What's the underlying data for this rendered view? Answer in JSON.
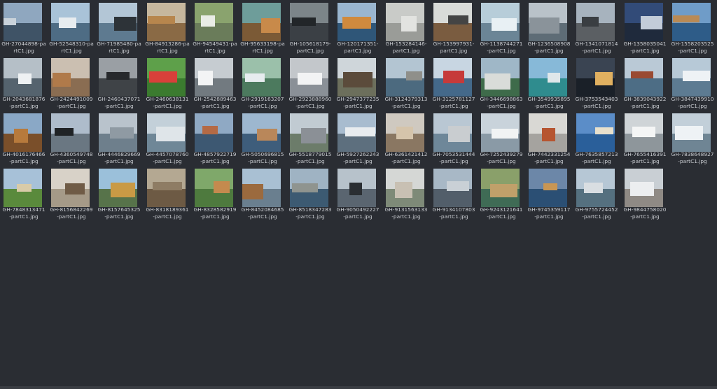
{
  "window": {
    "background": "#2a2d33"
  },
  "files": [
    {
      "name": "GH-27044898-partC1.jpg",
      "line1": "GH-27044898-pa",
      "line2": "rtC1.jpg",
      "sky": "#8fa7bf",
      "ground": "#3f5366",
      "bldg": "#c9d2da"
    },
    {
      "name": "GH-52548310-partC1.jpg",
      "line1": "GH-52548310-pa",
      "line2": "rtC1.jpg",
      "sky": "#a9c3d8",
      "ground": "#4e6c84",
      "bldg": "#e7ecef"
    },
    {
      "name": "GH-71985480-partC1.jpg",
      "line1": "GH-71985480-pa",
      "line2": "rtC1.jpg",
      "sky": "#b3c6d6",
      "ground": "#5e7a90",
      "bldg": "#2d3338"
    },
    {
      "name": "GH-84913286-partC1.jpg",
      "line1": "GH-84913286-pa",
      "line2": "rtC1.jpg",
      "sky": "#c6b79e",
      "ground": "#8a6a45",
      "bldg": "#b7864d"
    },
    {
      "name": "GH-94549431-partC1.jpg",
      "line1": "GH-94549431-pa",
      "line2": "rtC1.jpg",
      "sky": "#8aa36e",
      "ground": "#6a7c5a",
      "bldg": "#e9ece6"
    },
    {
      "name": "GH-95633198-partC1.jpg",
      "line1": "GH-95633198-pa",
      "line2": "rtC1.jpg",
      "sky": "#6e9d9a",
      "ground": "#7b5a36",
      "bldg": "#c88a4a"
    },
    {
      "name": "GH-105618179-partC1.jpg",
      "line1": "GH-105618179-",
      "line2": "partC1.jpg",
      "sky": "#7c8589",
      "ground": "#3b4045",
      "bldg": "#222629"
    },
    {
      "name": "GH-120171351-partC1.jpg",
      "line1": "GH-120171351-",
      "line2": "partC1.jpg",
      "sky": "#9ab6d0",
      "ground": "#2f5678",
      "bldg": "#d08a3e"
    },
    {
      "name": "GH-153284146-partC1.jpg",
      "line1": "GH-153284146-",
      "line2": "partC1.jpg",
      "sky": "#c9cbc8",
      "ground": "#9a9c98",
      "bldg": "#e2e3e0"
    },
    {
      "name": "GH-153997931-partC1.jpg",
      "line1": "GH-153997931-",
      "line2": "partC1.jpg",
      "sky": "#d9dbd8",
      "ground": "#7a5c40",
      "bldg": "#444"
    },
    {
      "name": "GH-1138744271-partC1.jpg",
      "line1": "GH-1138744271",
      "line2": "-partC1.jpg",
      "sky": "#b7cdd9",
      "ground": "#6b8596",
      "bldg": "#e8f0f4"
    },
    {
      "name": "GH-1236508908-partC1.jpg",
      "line1": "GH-1236508908",
      "line2": "-partC1.jpg",
      "sky": "#b9c2c9",
      "ground": "#5e6c76",
      "bldg": "#8a939a"
    },
    {
      "name": "GH-1341071814-partC1.jpg",
      "line1": "GH-1341071814",
      "line2": "-partC1.jpg",
      "sky": "#a7b3be",
      "ground": "#5b5f63",
      "bldg": "#3a3e42"
    },
    {
      "name": "GH-1358035041-partC1.jpg",
      "line1": "GH-1358035041",
      "line2": "-partC1.jpg",
      "sky": "#324b78",
      "ground": "#1f2a3c",
      "bldg": "#c3ccd9"
    },
    {
      "name": "GH-1558203525-partC1.jpg",
      "line1": "GH-1558203525",
      "line2": "-partC1.jpg",
      "sky": "#6f9cc8",
      "ground": "#2e5c88",
      "bldg": "#b98a55"
    },
    {
      "name": "GH-2043681876-partC1.jpg",
      "line1": "GH-2043681876",
      "line2": "-partC1.jpg",
      "sky": "#b5bfc7",
      "ground": "#55636e",
      "bldg": "#eef1f3"
    },
    {
      "name": "GH-2424491009-partC1.jpg",
      "line1": "GH-2424491009",
      "line2": "-partC1.jpg",
      "sky": "#cbbfb1",
      "ground": "#8a6d52",
      "bldg": "#b07a4a"
    },
    {
      "name": "GH-2460437071-partC1.jpg",
      "line1": "GH-2460437071",
      "line2": "-partC1.jpg",
      "sky": "#9a9fa4",
      "ground": "#3f4347",
      "bldg": "#27292c"
    },
    {
      "name": "GH-2460638131-partC1.jpg",
      "line1": "GH-2460638131",
      "line2": "-partC1.jpg",
      "sky": "#5ea04a",
      "ground": "#3b7b2f",
      "bldg": "#d8403a"
    },
    {
      "name": "GH-2542889463-partC1.jpg",
      "line1": "GH-2542889463",
      "line2": "-partC1.jpg",
      "sky": "#c6ccd1",
      "ground": "#727a80",
      "bldg": "#f3f4f5"
    },
    {
      "name": "GH-2919163207-partC1.jpg",
      "line1": "GH-2919163207",
      "line2": "-partC1.jpg",
      "sky": "#9bc0aa",
      "ground": "#4c7a5e",
      "bldg": "#e7ecef"
    },
    {
      "name": "GH-2923888960-partC1.jpg",
      "line1": "GH-2923888960",
      "line2": "-partC1.jpg",
      "sky": "#c3c7cb",
      "ground": "#8a9097",
      "bldg": "#f2f3f4"
    },
    {
      "name": "GH-2947377235-partC1.jpg",
      "line1": "GH-2947377235",
      "line2": "-partC1.jpg",
      "sky": "#cfd6da",
      "ground": "#6c6f5c",
      "bldg": "#5b4b3b"
    },
    {
      "name": "GH-3124379313-partC1.jpg",
      "line1": "GH-3124379313",
      "line2": "-partC1.jpg",
      "sky": "#b3c5d2",
      "ground": "#4c6a7f",
      "bldg": "#8f8f8a"
    },
    {
      "name": "GH-3125781127-partC1.jpg",
      "line1": "GH-3125781127",
      "line2": "-partC1.jpg",
      "sky": "#c8d6e2",
      "ground": "#44698a",
      "bldg": "#c63a3a"
    },
    {
      "name": "GH-3446698863-partC1.jpg",
      "line1": "GH-3446698863",
      "line2": "-partC1.jpg",
      "sky": "#9fb7c7",
      "ground": "#3e6b4a",
      "bldg": "#d9dcd9"
    },
    {
      "name": "GH-3549935895-partC1.jpg",
      "line1": "GH-3549935895",
      "line2": "-partC1.jpg",
      "sky": "#87b9d8",
      "ground": "#2f8c8e",
      "bldg": "#dfe7ea"
    },
    {
      "name": "GH-3753543403-partC1.jpg",
      "line1": "GH-3753543403",
      "line2": "-partC1.jpg",
      "sky": "#3a4452",
      "ground": "#1a2028",
      "bldg": "#e0b060"
    },
    {
      "name": "GH-3839043922-partC1.jpg",
      "line1": "GH-3839043922",
      "line2": "-partC1.jpg",
      "sky": "#bac9d6",
      "ground": "#4d6d85",
      "bldg": "#9a4a32"
    },
    {
      "name": "GH-3847439910-partC1.jpg",
      "line1": "GH-3847439910",
      "line2": "-partC1.jpg",
      "sky": "#b7c9d7",
      "ground": "#5d7b92",
      "bldg": "#eef2f5"
    },
    {
      "name": "GH-4016176466-partC1.jpg",
      "line1": "GH-4016176466",
      "line2": "-partC1.jpg",
      "sky": "#8aa8c6",
      "ground": "#7a4f2a",
      "bldg": "#b77a3c"
    },
    {
      "name": "GH-4360549748-partC1.jpg",
      "line1": "GH-4360549748",
      "line2": "-partC1.jpg",
      "sky": "#aebccb",
      "ground": "#6a7782",
      "bldg": "#202326"
    },
    {
      "name": "GH-4446829669-partC1.jpg",
      "line1": "GH-4446829669",
      "line2": "-partC1.jpg",
      "sky": "#b9c3cc",
      "ground": "#6e7f8c",
      "bldg": "#8f9aa3"
    },
    {
      "name": "GH-4457078760-partC1.jpg",
      "line1": "GH-4457078760",
      "line2": "-partC1.jpg",
      "sky": "#c3d0d9",
      "ground": "#6f8797",
      "bldg": "#dfe5e9"
    },
    {
      "name": "GH-4857922719-partC1.jpg",
      "line1": "GH-4857922719",
      "line2": "-partC1.jpg",
      "sky": "#8fa9c4",
      "ground": "#3d5872",
      "bldg": "#b46a45"
    },
    {
      "name": "GH-5050696815-partC1.jpg",
      "line1": "GH-5050696815",
      "line2": "-partC1.jpg",
      "sky": "#9db7cf",
      "ground": "#3e5d7b",
      "bldg": "#b9875a"
    },
    {
      "name": "GH-5518779015-partC1.jpg",
      "line1": "GH-5518779015",
      "line2": "-partC1.jpg",
      "sky": "#c1cbd2",
      "ground": "#6c7c6a",
      "bldg": "#8b9096"
    },
    {
      "name": "GH-5927262243-partC1.jpg",
      "line1": "GH-5927262243",
      "line2": "-partC1.jpg",
      "sky": "#a8bccf",
      "ground": "#5d6f7e",
      "bldg": "#e8ecef"
    },
    {
      "name": "GH-6361421412-partC1.jpg",
      "line1": "GH-6361421412",
      "line2": "-partC1.jpg",
      "sky": "#cfc9c0",
      "ground": "#8a7762",
      "bldg": "#d5c4ab"
    },
    {
      "name": "GH-7053531444-partC1.jpg",
      "line1": "GH-7053531444",
      "line2": "-partC1.jpg",
      "sky": "#b9c7d3",
      "ground": "#6e8799",
      "bldg": "#c9cdd0"
    },
    {
      "name": "GH-7252439279-partC1.jpg",
      "line1": "GH-7252439279",
      "line2": "-partC1.jpg",
      "sky": "#c9d3db",
      "ground": "#8a9aa6",
      "bldg": "#f1f3f4"
    },
    {
      "name": "GH-7442331254-partC1.jpg",
      "line1": "GH-7442331254",
      "line2": "-partC1.jpg",
      "sky": "#d9d8d4",
      "ground": "#a5a39f",
      "bldg": "#b65530"
    },
    {
      "name": "GH-7635857213-partC1.jpg",
      "line1": "GH-7635857213",
      "line2": "-partC1.jpg",
      "sky": "#5b8dc8",
      "ground": "#2a5f9a",
      "bldg": "#e8e0cc"
    },
    {
      "name": "GH-7655416391-partC1.jpg",
      "line1": "GH-7655416391",
      "line2": "-partC1.jpg",
      "sky": "#cfd4d7",
      "ground": "#8e969b",
      "bldg": "#f4f5f5"
    },
    {
      "name": "GH-7838648927-partC1.jpg",
      "line1": "GH-7838648927",
      "line2": "-partC1.jpg",
      "sky": "#c2cfd9",
      "ground": "#6f8594",
      "bldg": "#eef2f5"
    },
    {
      "name": "GH-7848313471-partC1.jpg",
      "line1": "GH-7848313471",
      "line2": "-partC1.jpg",
      "sky": "#a7c1d8",
      "ground": "#5a8a3c",
      "bldg": "#d9cba8"
    },
    {
      "name": "GH-8156842269-partC1.jpg",
      "line1": "GH-8156842269",
      "line2": "-partC1.jpg",
      "sky": "#d8d2c8",
      "ground": "#a59a88",
      "bldg": "#6f5b46"
    },
    {
      "name": "GH-8157645325-partC1.jpg",
      "line1": "GH-8157645325",
      "line2": "-partC1.jpg",
      "sky": "#9bc0da",
      "ground": "#57734a",
      "bldg": "#c99a45"
    },
    {
      "name": "GH-8318189361-partC1.jpg",
      "line1": "GH-8318189361",
      "line2": "-partC1.jpg",
      "sky": "#b4a892",
      "ground": "#6d5a44",
      "bldg": "#8e7c64"
    },
    {
      "name": "GH-8328582919-partC1.jpg",
      "line1": "GH-8328582919",
      "line2": "-partC1.jpg",
      "sky": "#7fa86a",
      "ground": "#4e7a3e",
      "bldg": "#c48a4e"
    },
    {
      "name": "GH-8452084685-partC1.jpg",
      "line1": "GH-8452084685",
      "line2": "-partC1.jpg",
      "sky": "#a9c0d3",
      "ground": "#6a7f8f",
      "bldg": "#9b6a3e"
    },
    {
      "name": "GH-8518347283-partC1.jpg",
      "line1": "GH-8518347283",
      "line2": "-partC1.jpg",
      "sky": "#9fb3c3",
      "ground": "#3c5a72",
      "bldg": "#8f948f"
    },
    {
      "name": "GH-9050492227-partC1.jpg",
      "line1": "GH-9050492227",
      "line2": "-partC1.jpg",
      "sky": "#b7c2cb",
      "ground": "#5a6570",
      "bldg": "#2a2e32"
    },
    {
      "name": "GH-9131563133-partC1.jpg",
      "line1": "GH-9131563133",
      "line2": "-partC1.jpg",
      "sky": "#d5d7d5",
      "ground": "#7e8a78",
      "bldg": "#c8c0b3"
    },
    {
      "name": "GH-9134107803-partC1.jpg",
      "line1": "GH-9134107803",
      "line2": "-partC1.jpg",
      "sky": "#a8b8c6",
      "ground": "#525e6a",
      "bldg": "#c9d0d6"
    },
    {
      "name": "GH-9243121641-partC1.jpg",
      "line1": "GH-9243121641",
      "line2": "-partC1.jpg",
      "sky": "#8aa06a",
      "ground": "#3f6b55",
      "bldg": "#c0a06a"
    },
    {
      "name": "GH-9745359117-partC1.jpg",
      "line1": "GH-9745359117",
      "line2": "-partC1.jpg",
      "sky": "#6c87a8",
      "ground": "#2b4f74",
      "bldg": "#c99653"
    },
    {
      "name": "GH-9755724452-partC1.jpg",
      "line1": "GH-9755724452",
      "line2": "-partC1.jpg",
      "sky": "#b6c7d5",
      "ground": "#55707f",
      "bldg": "#d9dee2"
    },
    {
      "name": "GH-9844758020-partC1.jpg",
      "line1": "GH-9844758020",
      "line2": "-partC1.jpg",
      "sky": "#c9cfd4",
      "ground": "#8f8a85",
      "bldg": "#eceef0"
    }
  ]
}
